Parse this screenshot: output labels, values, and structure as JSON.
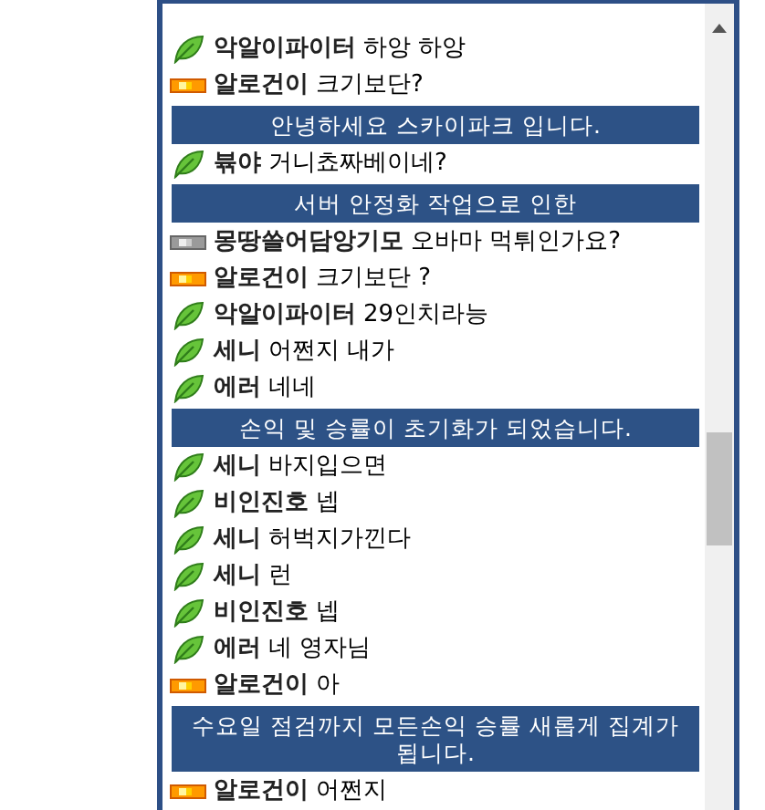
{
  "chat": [
    {
      "kind": "leaf_message",
      "user": "악알이파이터",
      "text": "하앙 하앙"
    },
    {
      "kind": "gold_message",
      "user": "알로건이",
      "text": "크기보단?"
    },
    {
      "kind": "notice",
      "text": "안녕하세요 스카이파크 입니다."
    },
    {
      "kind": "leaf_message",
      "user": "뷲야",
      "text": "거니쵸짜베이네?"
    },
    {
      "kind": "notice",
      "text": "서버 안정화 작업으로 인한"
    },
    {
      "kind": "silver_message",
      "user": "몽땅쓸어담앙기모",
      "text": "오바마 먹튀인가요?"
    },
    {
      "kind": "gold_message",
      "user": "알로건이",
      "text": "크기보단 ?"
    },
    {
      "kind": "leaf_message",
      "user": "악알이파이터",
      "text": "29인치라능"
    },
    {
      "kind": "leaf_message",
      "user": "세니",
      "text": "어쩐지 내가"
    },
    {
      "kind": "leaf_message",
      "user": "에러",
      "text": "네네"
    },
    {
      "kind": "notice",
      "text": "손익 및 승률이 초기화가 되었습니다."
    },
    {
      "kind": "leaf_message",
      "user": "세니",
      "text": "바지입으면"
    },
    {
      "kind": "leaf_message",
      "user": "비인진호",
      "text": "넵"
    },
    {
      "kind": "leaf_message",
      "user": "세니",
      "text": "허벅지가낀다"
    },
    {
      "kind": "leaf_message",
      "user": "세니",
      "text": "런"
    },
    {
      "kind": "leaf_message",
      "user": "비인진호",
      "text": "넵"
    },
    {
      "kind": "leaf_message",
      "user": "에러",
      "text": "네 영자님"
    },
    {
      "kind": "gold_message",
      "user": "알로건이",
      "text": "아"
    },
    {
      "kind": "notice",
      "text": "수요일 점검까지 모든손익 승률 새롭게 집계가 됩니다."
    },
    {
      "kind": "gold_message",
      "user": "알로건이",
      "text": "어쩐지"
    }
  ]
}
